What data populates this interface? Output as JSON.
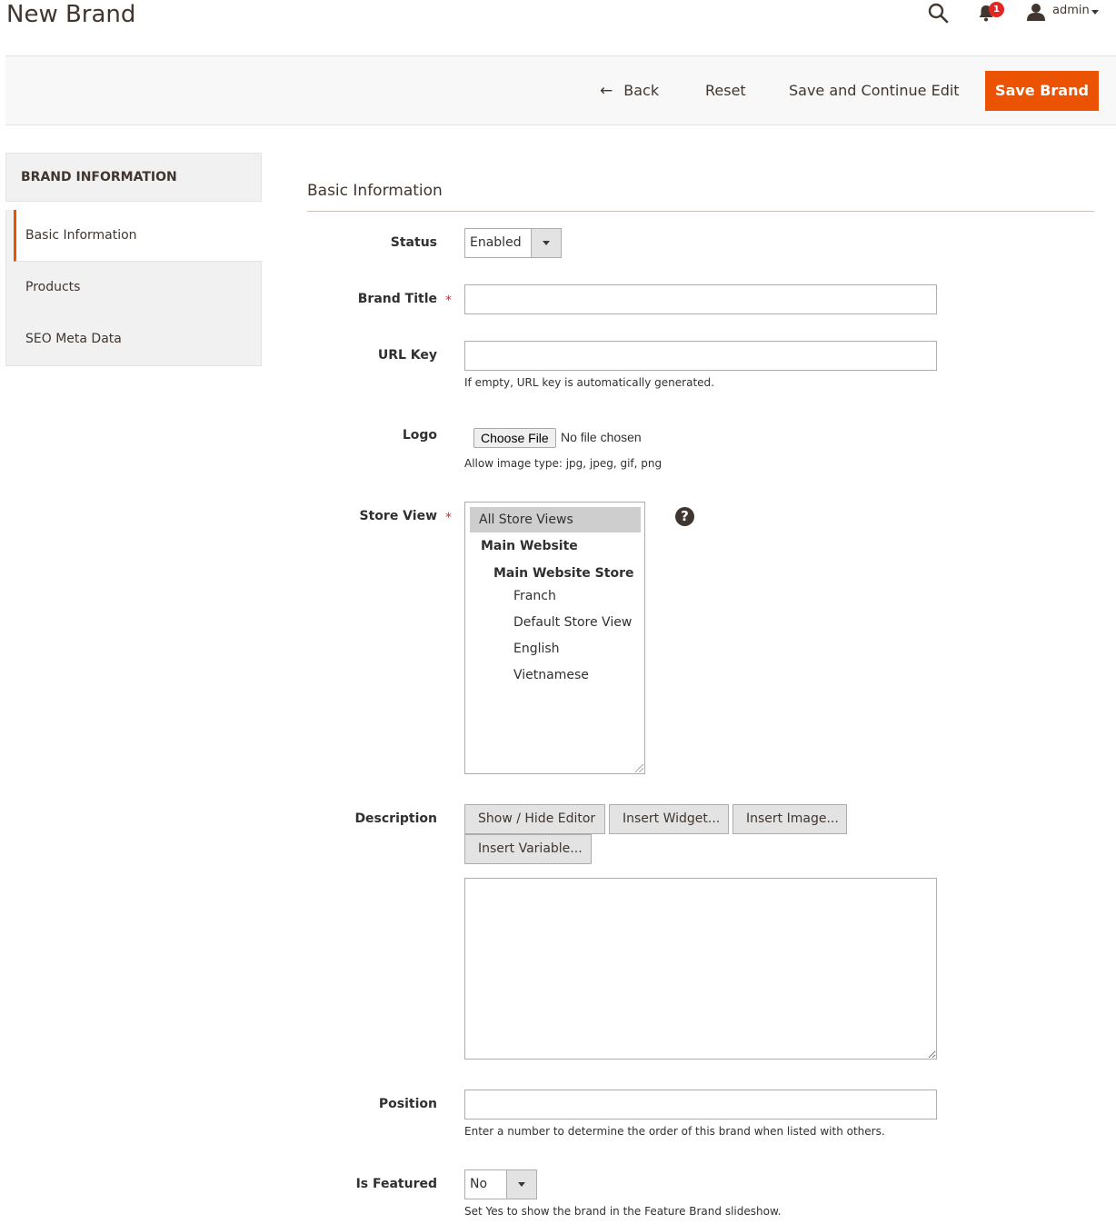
{
  "header": {
    "page_title": "New Brand",
    "notifications_count": "1",
    "user_name": "admin"
  },
  "actions": {
    "back_label": "Back",
    "back_arrow": "←",
    "reset_label": "Reset",
    "save_continue_label": "Save and Continue Edit",
    "save_label": "Save Brand"
  },
  "sidebar": {
    "title": "BRAND INFORMATION",
    "items": [
      {
        "label": "Basic Information",
        "active": true
      },
      {
        "label": "Products",
        "active": false
      },
      {
        "label": "SEO Meta Data",
        "active": false
      }
    ]
  },
  "form": {
    "section_title": "Basic Information",
    "required_mark": "*",
    "status": {
      "label": "Status",
      "value": "Enabled"
    },
    "brand_title": {
      "label": "Brand Title",
      "value": ""
    },
    "url_key": {
      "label": "URL Key",
      "value": "",
      "note": "If empty, URL key is automatically generated."
    },
    "logo": {
      "label": "Logo",
      "button_label": "Choose File",
      "status_text": "No file chosen",
      "note": "Allow image type: jpg, jpeg, gif, png"
    },
    "store_view": {
      "label": "Store View",
      "help_icon": "?",
      "options": [
        {
          "label": "All Store Views",
          "selected": true,
          "type": "option"
        },
        {
          "label": "Main Website",
          "type": "website"
        },
        {
          "label": "Main Website Store",
          "type": "store"
        },
        {
          "label": "Franch",
          "type": "view"
        },
        {
          "label": "Default Store View",
          "type": "view"
        },
        {
          "label": "English",
          "type": "view"
        },
        {
          "label": "Vietnamese",
          "type": "view"
        }
      ]
    },
    "description": {
      "label": "Description",
      "buttons": [
        "Show / Hide Editor",
        "Insert Widget...",
        "Insert Image...",
        "Insert Variable..."
      ],
      "value": ""
    },
    "position": {
      "label": "Position",
      "value": "",
      "note": "Enter a number to determine the order of this brand when listed with others."
    },
    "is_featured": {
      "label": "Is Featured",
      "value": "No",
      "note": "Set Yes to show the brand in the Feature Brand slideshow."
    }
  }
}
